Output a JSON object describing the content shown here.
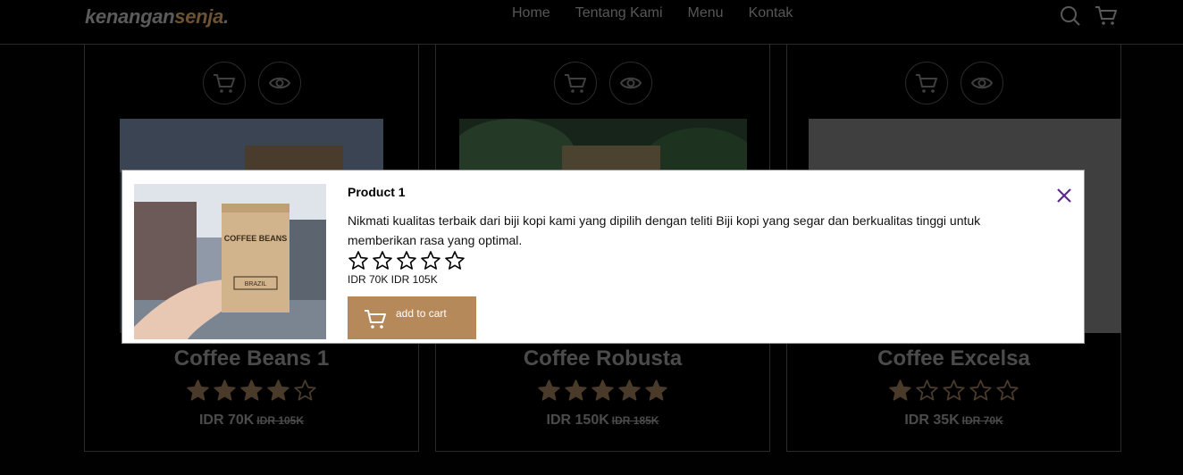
{
  "navbar": {
    "logo_main": "kenangan",
    "logo_accent": "senja",
    "logo_dot": ".",
    "links": [
      "Home",
      "Tentang Kami",
      "Menu",
      "Kontak"
    ],
    "icons": [
      "search-icon",
      "shopping-cart-icon"
    ]
  },
  "products": [
    {
      "name": "Coffee Beans 1",
      "rating": 4,
      "price": "IDR 70K",
      "old_price": "IDR 105K"
    },
    {
      "name": "Coffee Robusta",
      "rating": 5,
      "price": "IDR 150K",
      "old_price": "IDR 185K"
    },
    {
      "name": "Coffee Excelsa",
      "rating": 1,
      "price": "IDR 35K",
      "old_price": "IDR 70K"
    }
  ],
  "card_icons": [
    "shopping-cart-icon",
    "eye-icon"
  ],
  "modal": {
    "title": "Product 1",
    "description": "Nikmati kualitas terbaik dari biji kopi kami yang dipilih dengan teliti Biji kopi yang segar dan berkualitas tinggi untuk memberikan rasa yang optimal.",
    "rating": 0,
    "price_line": "IDR 70K IDR 105K",
    "add_to_cart_label": "add to cart",
    "close_icon": "close-icon",
    "bag_text": "COFFEE BEANS",
    "bag_label": "BRAZIL"
  },
  "colors": {
    "accent": "#b6895b",
    "star_dim": "#4a3a2a",
    "modal_close": "#5b2a86"
  }
}
